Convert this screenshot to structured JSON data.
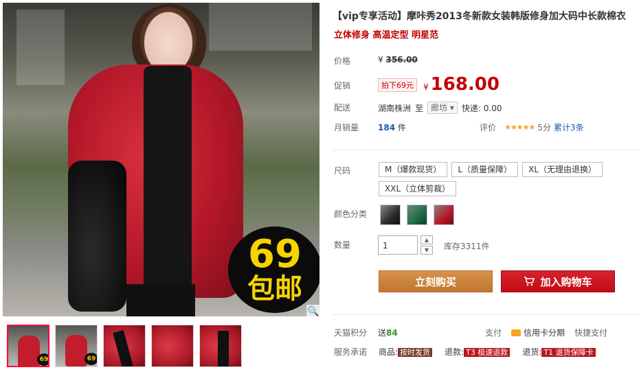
{
  "product": {
    "title": "【vip专享活动】摩咔秀2013冬新款女装韩版修身加大码中长款棉衣",
    "subtitle": "立体修身 高温定型 明星范",
    "badge_number": "69",
    "badge_text": "包邮"
  },
  "price": {
    "label": "价格",
    "currency": "¥",
    "original": "356.00"
  },
  "promo": {
    "label": "促销",
    "tag": "拍下69元",
    "currency": "¥",
    "price": "168.00"
  },
  "shipping": {
    "label": "配送",
    "from": "湖南株洲",
    "to_word": "至",
    "destination": "廊坊",
    "express": "快递: 0.00"
  },
  "sales": {
    "label": "月销量",
    "count": "184",
    "unit": "件",
    "rating_label": "评价",
    "stars": "★★★★★",
    "score": "5分",
    "total": "累计3条"
  },
  "size": {
    "label": "尺码",
    "options": [
      "M（爆款现货）",
      "L（质量保障）",
      "XL（无理由退换）",
      "XXL（立体剪裁）"
    ]
  },
  "color": {
    "label": "颜色分类",
    "swatches": [
      "#2a2a2a",
      "#1f6b4a",
      "#b5182a"
    ]
  },
  "quantity": {
    "label": "数量",
    "value": "1",
    "stock": "库存3311件"
  },
  "actions": {
    "buy": "立刻购买",
    "cart": "加入购物车"
  },
  "points": {
    "label": "天猫积分",
    "prefix": "送",
    "value": "84"
  },
  "payment": {
    "label": "支付",
    "credit": "信用卡分期",
    "quick": "快捷支付"
  },
  "service": {
    "label": "服务承诺",
    "goods_label": "商品:",
    "goods_tag": "按时发货",
    "refund_label": "退款:",
    "refund_tag": "T3 极速退款",
    "return_label": "退货:",
    "return_tag": "T1 退货保障卡"
  },
  "icons": {
    "zoom": "🔍",
    "cart": "cart-icon",
    "up": "▲",
    "down": "▼",
    "dropdown": "▾"
  },
  "colors": {
    "accent": "#c40000",
    "buy": "#c0762e",
    "cart": "#c10b15"
  }
}
